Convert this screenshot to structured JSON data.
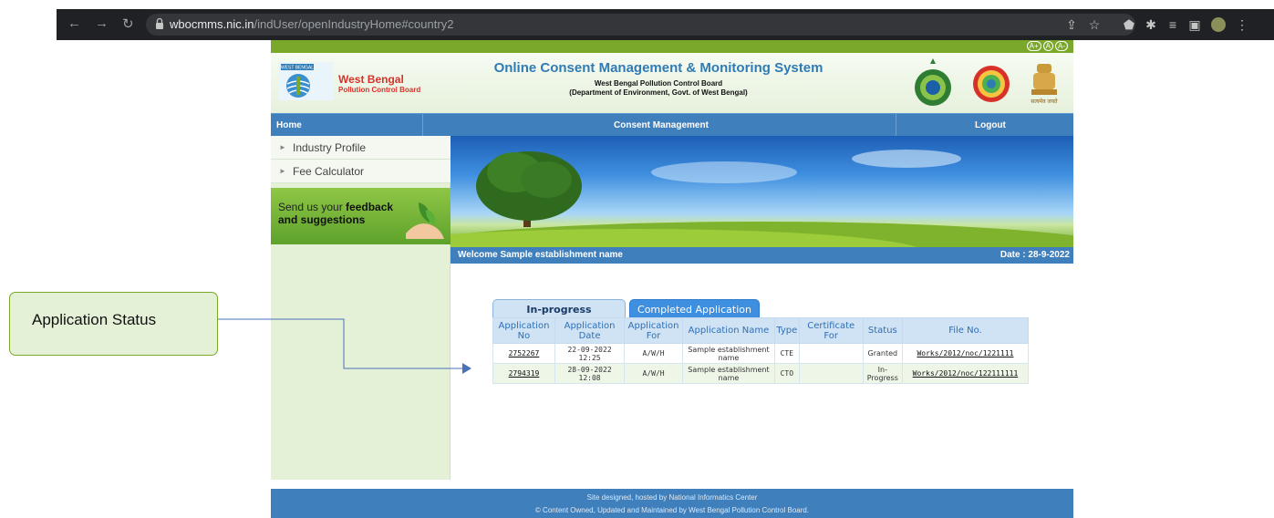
{
  "browser": {
    "url_host": "wbocmms.nic.in",
    "url_path": "/indUser/openIndustryHome#country2"
  },
  "site": {
    "font_size_controls": [
      "A+",
      "A",
      "A-"
    ],
    "brand_line1": "West Bengal",
    "brand_line2": "Pollution Control Board",
    "logo_text": "WEST BENGAL",
    "title": "Online Consent Management & Monitoring System",
    "subtitle1": "West Bengal Pollution Control Board",
    "subtitle2": "(Department of Environment, Govt. of West Bengal)",
    "emblem_motto": "सत्यमेव जयते"
  },
  "menu": {
    "home": "Home",
    "consent": "Consent Management",
    "logout": "Logout"
  },
  "sidebar": {
    "items": [
      {
        "label": "Industry Profile"
      },
      {
        "label": "Fee Calculator"
      }
    ],
    "feedback_line1_prefix": "Send us your ",
    "feedback_line1_bold": "feedback",
    "feedback_line2": "and suggestions"
  },
  "welcome": {
    "text": "Welcome Sample establishment name",
    "date": "Date : 28-9-2022"
  },
  "tabs": {
    "inprogress": "In-progress Application",
    "completed": "Completed Application"
  },
  "table": {
    "headers": [
      "Application No",
      "Application Date",
      "Application For",
      "Application Name",
      "Type",
      "Certificate For",
      "Status",
      "File No."
    ],
    "rows": [
      {
        "no": "2752267",
        "date": "22-09-2022 12:25",
        "for": "A/W/H",
        "name": "Sample establishment name",
        "type": "CTE",
        "cert": "",
        "status": "Granted",
        "file": "Works/2012/noc/1221111"
      },
      {
        "no": "2794319",
        "date": "28-09-2022 12:08",
        "for": "A/W/H",
        "name": "Sample establishment name",
        "type": "CTO",
        "cert": "",
        "status": "In-Progress",
        "file": "Works/2012/noc/122111111"
      }
    ]
  },
  "footer": {
    "line1": "Site designed, hosted by National Informatics Center",
    "line2": "© Content Owned, Updated and Maintained by West Bengal Pollution Control Board."
  },
  "annotation": {
    "label": "Application Status"
  },
  "colors": {
    "menu_blue": "#3f7fbb",
    "accent_green": "#7aa82a",
    "sidebar_green": "#e4f1d7",
    "annotation_arrow": "#4a72b8"
  }
}
